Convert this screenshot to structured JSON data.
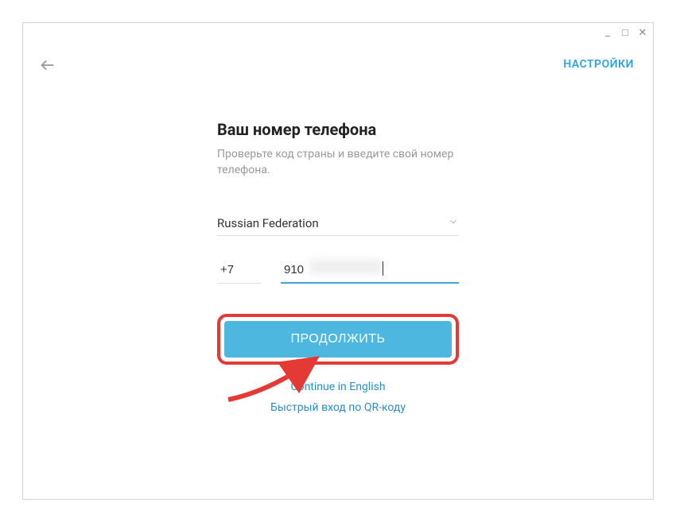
{
  "window": {
    "minimize": "_",
    "maximize": "□",
    "close": "✕"
  },
  "header": {
    "settings": "НАСТРОЙКИ"
  },
  "main": {
    "title": "Ваш номер телефона",
    "subtitle": "Проверьте код страны и введите свой номер телефона.",
    "country": "Russian Federation",
    "country_code": "+7",
    "phone_value": "910",
    "continue": "ПРОДОЛЖИТЬ",
    "continue_english": "Continue in English",
    "qr_login": "Быстрый вход по QR-коду"
  }
}
